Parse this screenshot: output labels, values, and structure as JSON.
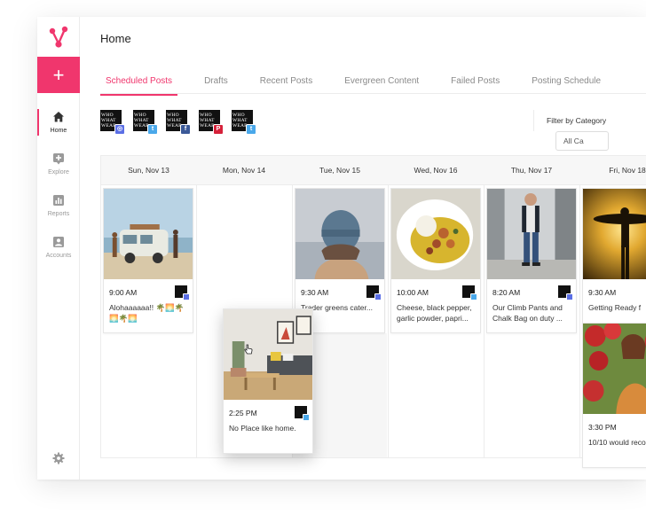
{
  "app": {
    "page_title": "Home"
  },
  "colors": {
    "accent": "#f0366d",
    "instagram": "#5b6fe5",
    "twitter": "#4aa8ea",
    "facebook": "#3b5998",
    "pinterest": "#d6213a"
  },
  "sidebar": {
    "add_label": "+",
    "items": [
      {
        "label": "Home",
        "icon": "home-icon"
      },
      {
        "label": "Explore",
        "icon": "explore-icon"
      },
      {
        "label": "Reports",
        "icon": "reports-icon"
      },
      {
        "label": "Accounts",
        "icon": "accounts-icon"
      }
    ],
    "settings_icon": "gear-icon"
  },
  "tabs": [
    {
      "label": "Scheduled Posts"
    },
    {
      "label": "Drafts"
    },
    {
      "label": "Recent Posts"
    },
    {
      "label": "Evergreen Content"
    },
    {
      "label": "Failed Posts"
    },
    {
      "label": "Posting Schedule"
    }
  ],
  "accounts": [
    {
      "avatar_text": "WHO WHAT WEAR",
      "network": "instagram",
      "badge": "◎"
    },
    {
      "avatar_text": "WHO WHAT WEAR",
      "network": "twitter",
      "badge": "t"
    },
    {
      "avatar_text": "WHO WHAT WEAR",
      "network": "facebook",
      "badge": "f"
    },
    {
      "avatar_text": "WHO WHAT WEAR",
      "network": "pinterest",
      "badge": "P"
    },
    {
      "avatar_text": "WHO WHAT WEAR",
      "network": "twitter",
      "badge": "t"
    }
  ],
  "filter": {
    "label": "Filter by Category",
    "selected": "All Ca"
  },
  "calendar": {
    "days": [
      "Sun, Nov 13",
      "Mon, Nov 14",
      "Tue, Nov 15",
      "Wed, Nov 16",
      "Thu, Nov 17",
      "Fri, Nov 18"
    ],
    "posts": [
      {
        "time": "9:00 AM",
        "caption": "Alohaaaaaa!! 🌴🌅🌴 🌅🌴🌅",
        "network": "instagram",
        "image": "van-beach"
      },
      {
        "time": "2:25 PM",
        "caption": "No Place like home.",
        "network": "twitter",
        "image": "living-room"
      },
      {
        "time": "9:30 AM",
        "caption": "Trader greens cater...",
        "network": "instagram",
        "image": "beanie"
      },
      {
        "time": "10:00 AM",
        "caption": "Cheese, black pepper, garlic powder, papri...",
        "network": "twitter",
        "image": "food-plate"
      },
      {
        "time": "8:20 AM",
        "caption": "Our Climb Pants and Chalk Bag on duty ...",
        "network": "instagram",
        "image": "street-man"
      },
      {
        "time": "9:30 AM",
        "caption": "Getting Ready f",
        "network": "instagram",
        "image": "surfer-sunset"
      },
      {
        "time": "3:30 PM",
        "caption": "10/10 would reco",
        "network": "instagram",
        "image": "flowers-woman"
      }
    ]
  }
}
